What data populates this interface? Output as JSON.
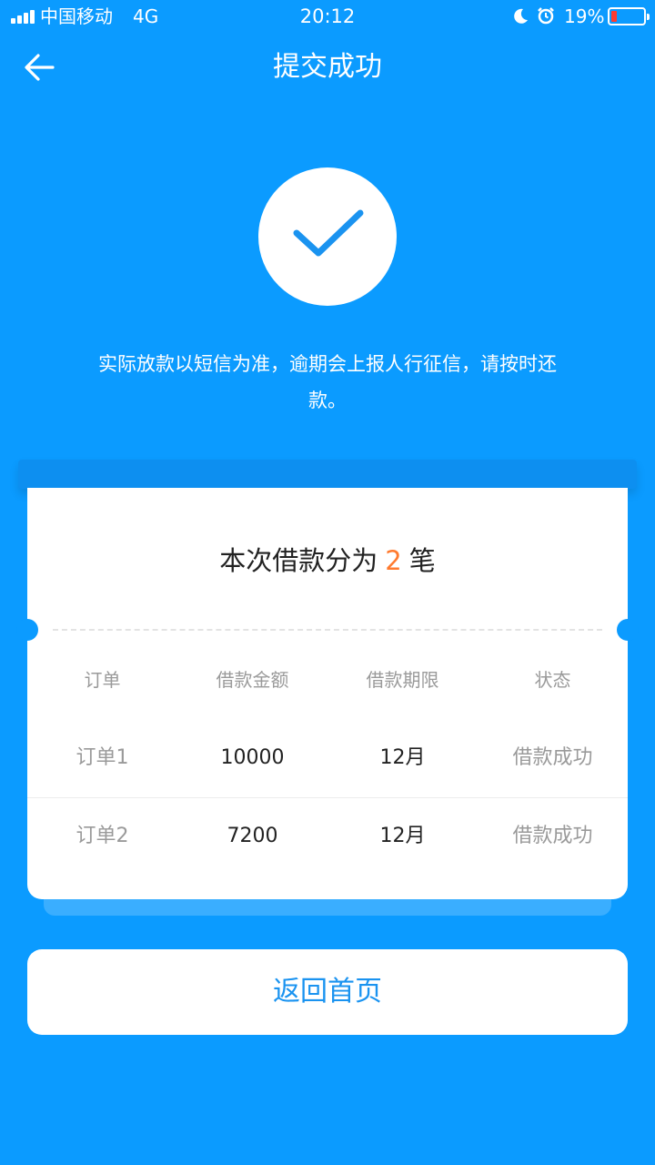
{
  "status_bar": {
    "carrier": "中国移动",
    "network": "4G",
    "time": "20:12",
    "battery_percent": "19%",
    "battery_level": 0.19,
    "battery_color": "#ff3b30",
    "icons": [
      "signal-icon",
      "moon-icon",
      "alarm-icon",
      "battery-icon"
    ]
  },
  "header": {
    "title": "提交成功",
    "back_icon": "arrow-left-icon"
  },
  "success": {
    "icon": "checkmark-icon",
    "notice": "实际放款以短信为准，逾期会上报人行征信，请按时还款。"
  },
  "card": {
    "summary_prefix": "本次借款分为",
    "summary_count": "2",
    "summary_suffix": "笔",
    "columns": [
      "订单",
      "借款金额",
      "借款期限",
      "状态"
    ],
    "rows": [
      {
        "order": "订单1",
        "amount": "10000",
        "term": "12月",
        "status": "借款成功"
      },
      {
        "order": "订单2",
        "amount": "7200",
        "term": "12月",
        "status": "借款成功"
      }
    ]
  },
  "footer": {
    "home_button": "返回首页"
  },
  "colors": {
    "background": "#0b9bff",
    "accent_text": "#1a93f0",
    "count_highlight": "#ff7a2e"
  }
}
